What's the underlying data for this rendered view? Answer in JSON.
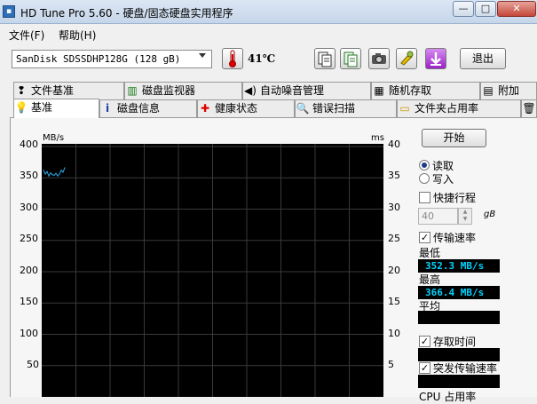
{
  "window": {
    "title": "HD Tune Pro 5.60 - 硬盘/固态硬盘实用程序",
    "icon_name": "hdd-app-icon",
    "controls": {
      "minimize": "—",
      "maximize": "□",
      "close": "✕"
    }
  },
  "menu": {
    "file": "文件(F)",
    "help": "帮助(H)"
  },
  "toolbar": {
    "drive": "SanDisk SDSSDHP128G (128 gB)",
    "temperature": "41℃",
    "exit_label": "退出",
    "icons": [
      "thermometer-icon",
      "info-icon",
      "copy-icon",
      "camera-icon",
      "settings-icon",
      "save-icon"
    ]
  },
  "tabs": {
    "row1": [
      {
        "label": "文件基准",
        "icon": "file-benchmark-icon"
      },
      {
        "label": "磁盘监视器",
        "icon": "disk-monitor-icon"
      },
      {
        "label": "自动噪音管理",
        "icon": "speaker-icon"
      },
      {
        "label": "随机存取",
        "icon": "random-access-icon"
      },
      {
        "label": "附加",
        "icon": "extra-icon"
      }
    ],
    "row2": [
      {
        "label": "基准",
        "icon": "benchmark-icon",
        "active": true
      },
      {
        "label": "磁盘信息",
        "icon": "info-icon"
      },
      {
        "label": "健康状态",
        "icon": "health-cross-icon"
      },
      {
        "label": "错误扫描",
        "icon": "magnifier-icon"
      },
      {
        "label": "文件夹占用率",
        "icon": "folder-icon"
      },
      {
        "label": "",
        "icon": "trash-icon"
      }
    ]
  },
  "chart": {
    "left_unit": "MB/s",
    "right_unit": "ms",
    "left_ticks": [
      "400",
      "350",
      "300",
      "250",
      "200",
      "150",
      "100",
      "50"
    ],
    "right_ticks": [
      "40",
      "35",
      "30",
      "25",
      "20",
      "15",
      "10",
      "5"
    ]
  },
  "chart_data": {
    "type": "line",
    "ylabel": "MB/s",
    "y2label": "ms",
    "ylim": [
      0,
      400
    ],
    "y2lim": [
      0,
      40
    ],
    "grid": true,
    "series": [
      {
        "color": "#2aa8e6",
        "x": [
          0,
          0.5,
          1,
          1.5,
          2,
          2.5,
          3,
          3.5,
          4,
          4.5,
          5,
          5.5,
          6
        ],
        "values": [
          362,
          356,
          360,
          353,
          358,
          355,
          354,
          357,
          353,
          356,
          362,
          359,
          366
        ]
      }
    ]
  },
  "controls": {
    "start_label": "开始",
    "read_label": "读取",
    "write_label": "写入",
    "read_selected": true,
    "quick_stroke_label": "快捷行程",
    "quick_stroke_checked": false,
    "size_value": "40",
    "size_unit": "gB",
    "transfer_rate_label": "传输速率",
    "transfer_rate_checked": true,
    "min_label": "最低",
    "min_value": "352.3 MB/s",
    "max_label": "最高",
    "max_value": "366.4 MB/s",
    "avg_label": "平均",
    "avg_value": "",
    "access_time_label": "存取时间",
    "access_time_checked": true,
    "access_time_value": "",
    "burst_rate_label": "突发传输速率",
    "burst_rate_checked": true,
    "burst_rate_value": "",
    "cpu_usage_label": "CPU 占用率"
  }
}
